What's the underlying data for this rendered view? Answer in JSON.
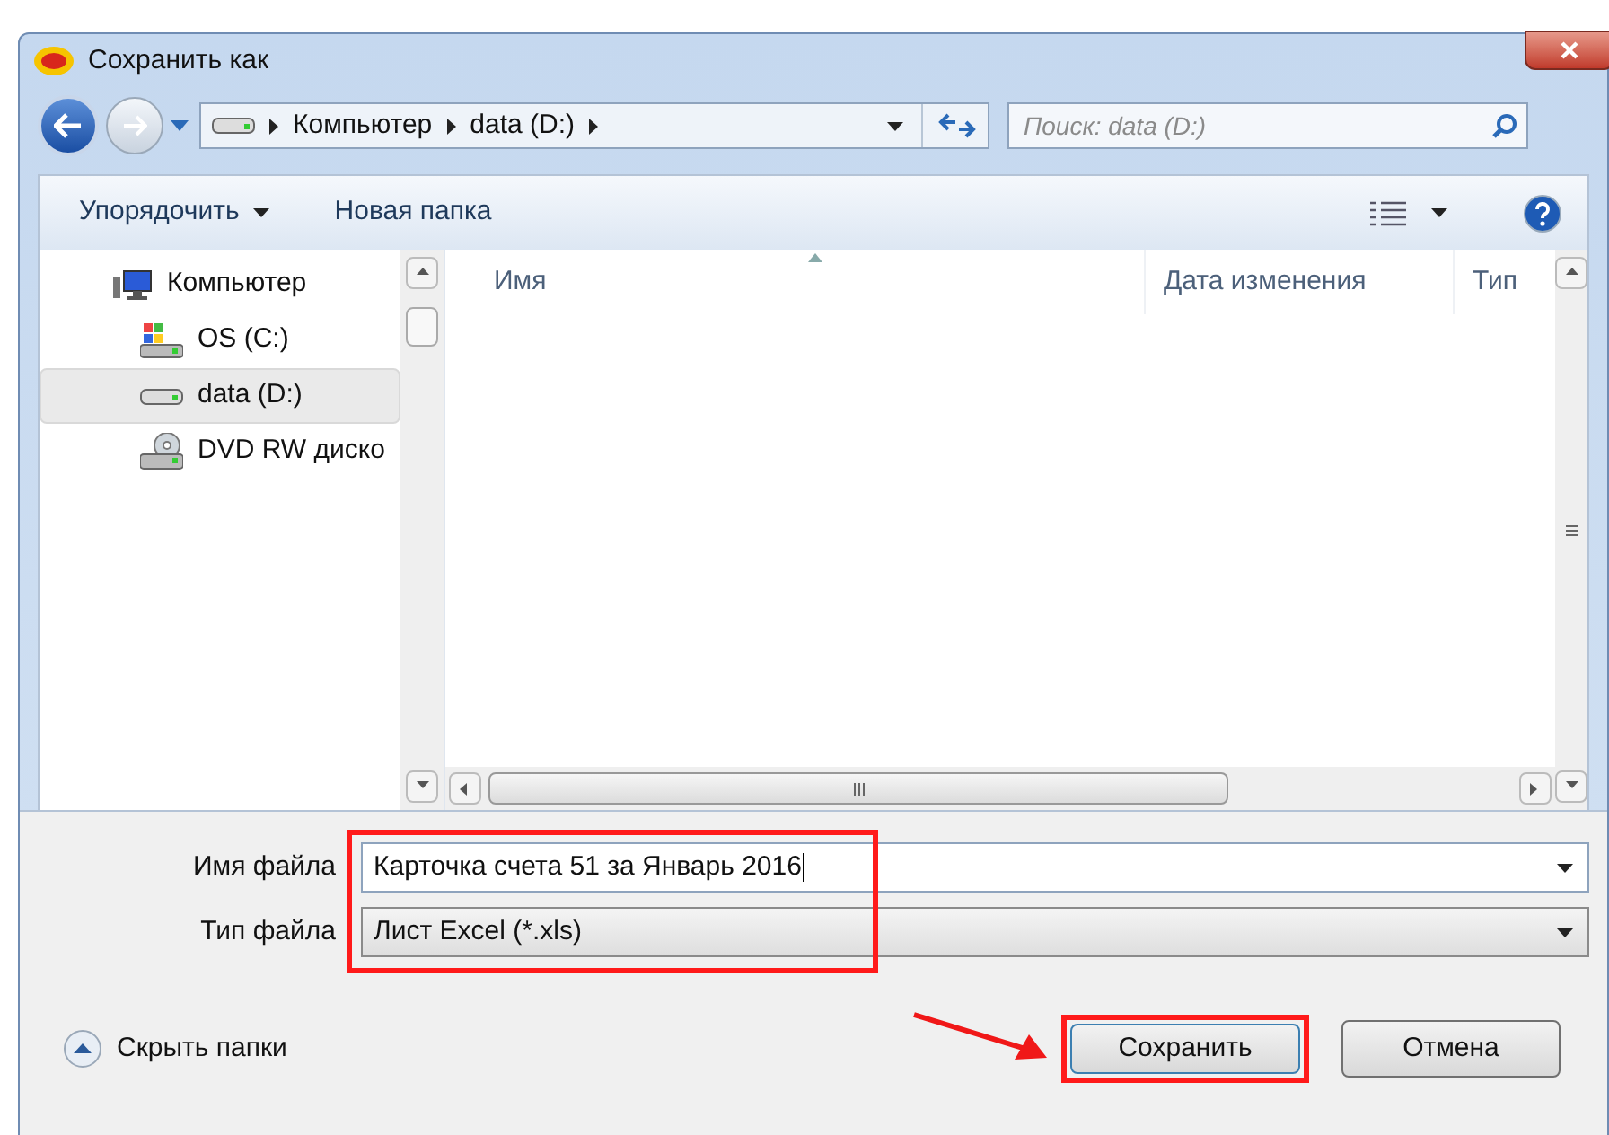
{
  "window": {
    "title": "Сохранить как"
  },
  "breadcrumb": [
    "Компьютер",
    "data (D:)"
  ],
  "search": {
    "placeholder": "Поиск: data (D:)"
  },
  "toolbar": {
    "organize": "Упорядочить",
    "new_folder": "Новая папка"
  },
  "sidebar": {
    "items": [
      {
        "label": "Компьютер",
        "kind": "computer",
        "selected": false,
        "children": [
          {
            "label": "OS (C:)",
            "kind": "system-drive",
            "selected": false
          },
          {
            "label": "data (D:)",
            "kind": "drive",
            "selected": true
          },
          {
            "label": "DVD RW диско",
            "kind": "dvd",
            "selected": false
          }
        ]
      }
    ]
  },
  "table": {
    "columns": [
      "Имя",
      "Дата изменения",
      "Тип"
    ]
  },
  "form": {
    "filename_label": "Имя файла",
    "filename": "Карточка счета 51 за Январь 2016",
    "filetype_label": "Тип файла",
    "filetype": "Лист Excel (*.xls)"
  },
  "hide_folders": "Скрыть папки",
  "buttons": {
    "save": "Сохранить",
    "cancel": "Отмена"
  }
}
